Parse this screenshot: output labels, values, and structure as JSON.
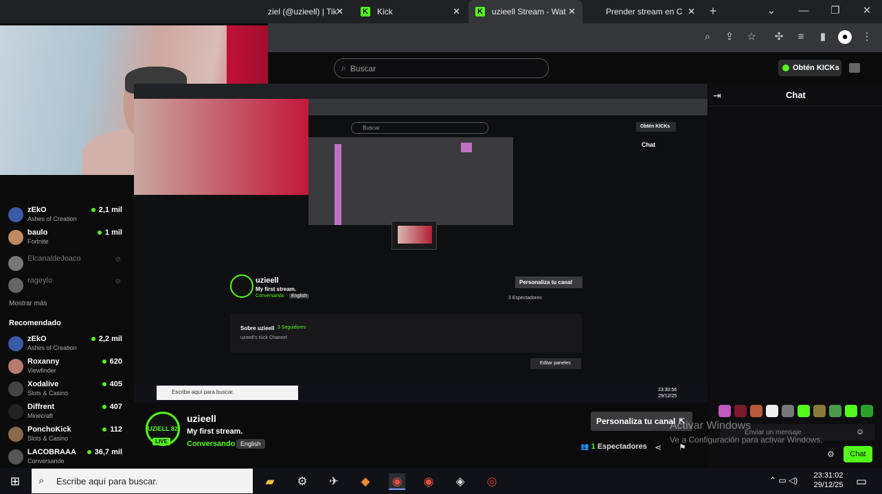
{
  "tabs": [
    {
      "label": "ziel (@uzieell) | Tik"
    },
    {
      "label": "Kick"
    },
    {
      "label": "uzieell Stream - Wat"
    },
    {
      "label": "Prender stream en C"
    }
  ],
  "kick": {
    "search_placeholder": "Buscar",
    "obten": "Obtén KICKs"
  },
  "chat": {
    "title": "Chat",
    "input_placeholder": "Enviar un mensaje",
    "send": "Chat"
  },
  "sidebar": {
    "following": [
      {
        "name": "zEkO",
        "category": "Ashes of Creation",
        "viewers": "2,1 mil",
        "live": true,
        "color": "#3b5ba8"
      },
      {
        "name": "baulo",
        "category": "Fortnite",
        "viewers": "1 mil",
        "live": true,
        "color": "#c08a60"
      },
      {
        "name": "ElcanaldeJoaco",
        "category": "",
        "viewers": "",
        "live": false,
        "color": "#777"
      },
      {
        "name": "rageylo",
        "category": "",
        "viewers": "",
        "live": false,
        "color": "#666"
      }
    ],
    "show_more": "Mostrar más",
    "recommended_title": "Recomendado",
    "recommended": [
      {
        "name": "zEkO",
        "category": "Ashes of Creation",
        "viewers": "2,2 mil",
        "color": "#3b5ba8"
      },
      {
        "name": "Roxanny",
        "category": "Viewfinder",
        "viewers": "620",
        "color": "#b77b6e"
      },
      {
        "name": "Xodalive",
        "category": "Slots & Casino",
        "viewers": "405",
        "color": "#444"
      },
      {
        "name": "Diffrent",
        "category": "Minecraft",
        "viewers": "407",
        "color": "#222"
      },
      {
        "name": "PonchoKick",
        "category": "Slots & Casino",
        "viewers": "112",
        "color": "#8a6a4a"
      },
      {
        "name": "LACOBRAAA",
        "category": "Conversando",
        "viewers": "36,7 mil",
        "color": "#555"
      }
    ]
  },
  "channel": {
    "avatar_text": "UZIELL 82",
    "live": "LIVE",
    "name": "uzieell",
    "title": "My first stream.",
    "category": "Conversando",
    "language": "English",
    "customize": "Personaliza tu canal",
    "viewers_count": "1",
    "viewers_label": "Espectadores"
  },
  "watermark": {
    "line1": "Activar Windows",
    "line2": "Ve a Configuración para activar Windows."
  },
  "taskbar": {
    "search_placeholder": "Escribe aquí para buscar.",
    "time": "23:31:02",
    "date": "29/12/25"
  },
  "nested": {
    "search": "Buscar",
    "obten": "Obtén KICKs",
    "chat": "Chat",
    "name": "uzieell",
    "title": "My first stream.",
    "category": "Conversando",
    "language": "English",
    "customize": "Personaliza tu canal",
    "viewers": "3 Espectadores",
    "about": "Sobre uzieell",
    "followers": "3 Seguidores",
    "about_text": "uzieell's Kick Channel",
    "edit_panels": "Editar paneles",
    "taskbar_search": "Escribe aquí para buscar.",
    "time": "23:30:56",
    "date": "29/12/25"
  }
}
